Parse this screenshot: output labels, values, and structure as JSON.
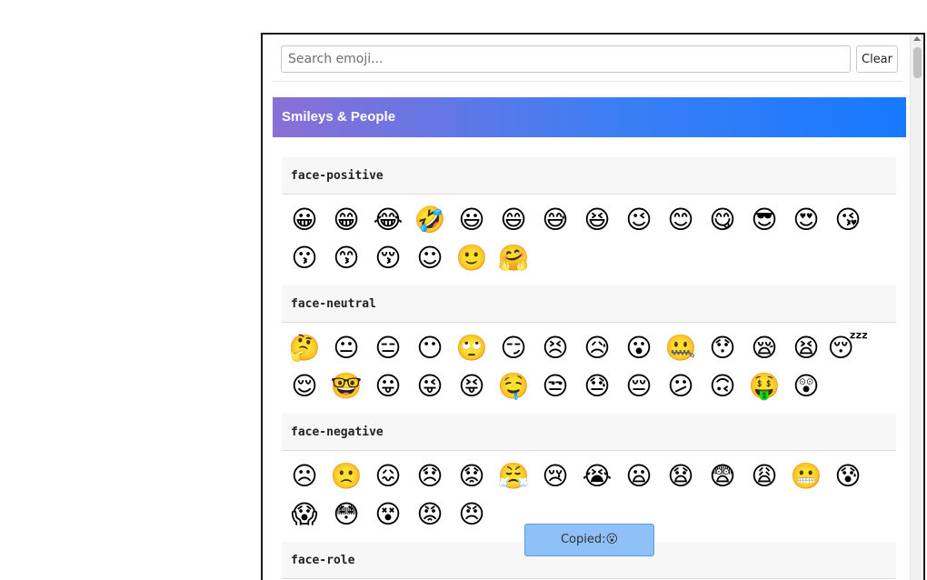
{
  "search": {
    "placeholder": "Search emoji...",
    "value": ""
  },
  "clear_label": "Clear",
  "category": {
    "title": "Smileys & People"
  },
  "groups": [
    {
      "name": "face-positive",
      "emojis": [
        "😀",
        "😁",
        "😂",
        "🤣",
        "😃",
        "😄",
        "😅",
        "😆",
        "😉",
        "😊",
        "😋",
        "😎",
        "😍",
        "😘",
        "😗",
        "😙",
        "😚",
        "☺",
        "🙂",
        "🤗"
      ]
    },
    {
      "name": "face-neutral",
      "emojis": [
        "🤔",
        "😐",
        "😑",
        "😶",
        "🙄",
        "😏",
        "😣",
        "😥",
        "😮",
        "🤐",
        "😯",
        "😪",
        "😫",
        "😴",
        "😌",
        "🤓",
        "😛",
        "😜",
        "😝",
        "🤤",
        "😒",
        "😓",
        "😔",
        "😕",
        "🙃",
        "🤑",
        "😲"
      ]
    },
    {
      "name": "face-negative",
      "emojis": [
        "☹",
        "🙁",
        "😖",
        "😞",
        "😟",
        "😤",
        "😢",
        "😭",
        "😦",
        "😧",
        "😨",
        "😩",
        "😬",
        "😰",
        "😱",
        "😳",
        "😵",
        "😡",
        "😠"
      ]
    },
    {
      "name": "face-role",
      "emojis": []
    }
  ],
  "toast": {
    "text": "Copied:😮"
  }
}
